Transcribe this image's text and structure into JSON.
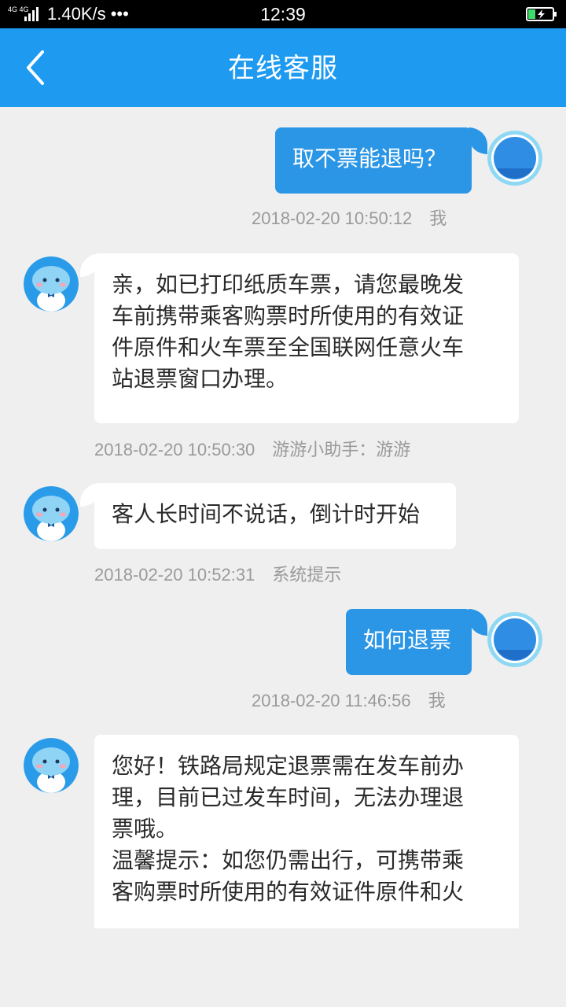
{
  "status_bar": {
    "network": "4G 4G",
    "speed": "1.40K/s •••",
    "time": "12:39"
  },
  "header": {
    "title": "在线客服",
    "back_icon": "chevron-left-icon"
  },
  "colors": {
    "primary": "#1e9bf0",
    "user_bubble": "#2b96e6",
    "background": "#efefef"
  },
  "messages": [
    {
      "side": "right",
      "text": "取不票能退吗？",
      "time": "2018-02-20 10:50:12",
      "sender": "我"
    },
    {
      "side": "left",
      "lines": [
        "亲，如已打印纸质车票，请您最晚发",
        "车前携带乘客购票时所使用的有效证",
        "件原件和火车票至全国联网任意火车",
        "站退票窗口办理。"
      ],
      "time": "2018-02-20 10:50:30",
      "sender": "游游小助手：游游"
    },
    {
      "side": "left",
      "text": "客人长时间不说话，倒计时开始",
      "time": "2018-02-20 10:52:31",
      "sender": "系统提示"
    },
    {
      "side": "right",
      "text": "如何退票",
      "time": "2018-02-20 11:46:56",
      "sender": "我"
    },
    {
      "side": "left",
      "lines": [
        "您好！铁路局规定退票需在发车前办",
        "理，目前已过发车时间，无法办理退",
        "票哦。",
        "温馨提示：如您仍需出行，可携带乘",
        "客购票时所使用的有效证件原件和火"
      ]
    }
  ]
}
